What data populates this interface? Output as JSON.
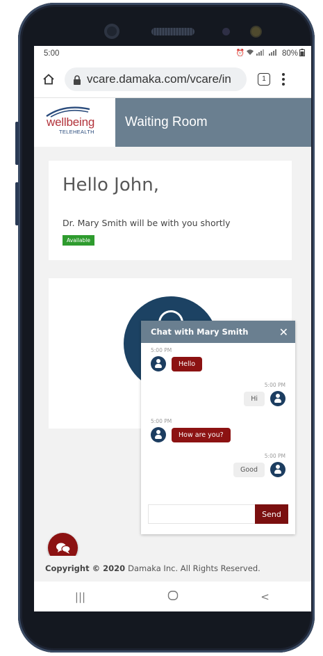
{
  "status_bar": {
    "time": "5:00",
    "icons": [
      "alarm-icon",
      "wifi-icon",
      "signal-icon",
      "signal-icon"
    ],
    "battery": "80%"
  },
  "browser": {
    "url": "vcare.damaka.com/vcare/in",
    "tab_count": "1"
  },
  "header": {
    "logo_text": "wellbeing",
    "logo_sub": "TELEHEALTH",
    "title": "Waiting Room"
  },
  "welcome": {
    "greeting": "Hello John,",
    "message": "Dr.  Mary Smith will be with you shortly",
    "status": "Available"
  },
  "chat": {
    "title": "Chat with Mary Smith",
    "messages": [
      {
        "time": "5:00 PM",
        "text": "Hello",
        "direction": "in"
      },
      {
        "time": "5:00 PM",
        "text": "Hi",
        "direction": "out"
      },
      {
        "time": "5:00 PM",
        "text": "How are you?",
        "direction": "in"
      },
      {
        "time": "5:00 PM",
        "text": "Good",
        "direction": "out"
      }
    ],
    "input_value": "",
    "send_label": "Send"
  },
  "footer": {
    "copyright_bold": "Copyright © 2020",
    "copyright_rest": "Damaka Inc. All Rights Reserved."
  },
  "nav": {
    "recents": "|||",
    "back": "<"
  },
  "colors": {
    "brand_red": "#8c1212",
    "header_slate": "#6a7f90",
    "avatar_navy": "#1c4263",
    "available_green": "#2e9b2e"
  }
}
